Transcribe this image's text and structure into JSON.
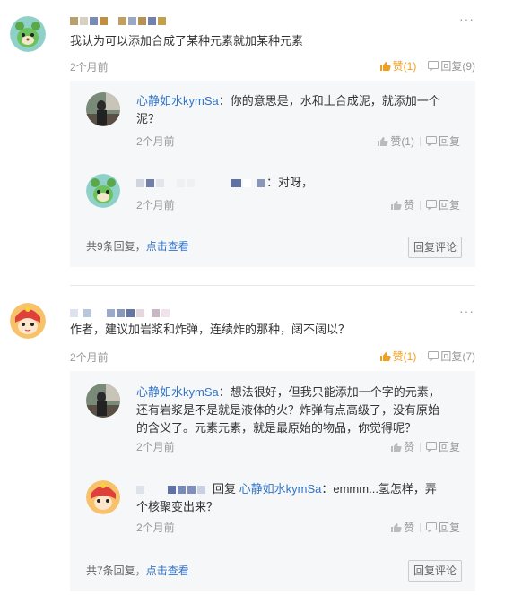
{
  "comments": [
    {
      "user_name": "",
      "text": "我认为可以添加合成了某种元素就加某种元素",
      "time": "2个月前",
      "like_label": "赞(1)",
      "reply_label": "回复(9)",
      "replies": [
        {
          "user_name": "心静如水kymSa",
          "text": "：你的意思是，水和土合成泥，就添加一个",
          "text2": "泥？",
          "time": "2个月前",
          "like_label": "赞(1)",
          "reply_label": "回复"
        },
        {
          "user_name": "",
          "text": "：对呀，",
          "time": "2个月前",
          "like_label": "赞",
          "reply_label": "回复"
        }
      ],
      "total_replies": "共9条回复，",
      "view_more": "点击查看",
      "reply_comment_btn": "回复评论"
    },
    {
      "user_name": "",
      "text": "作者，建议加岩浆和炸弹，连续炸的那种，阔不阔以？",
      "time": "2个月前",
      "like_label": "赞(1)",
      "reply_label": "回复(7)",
      "replies": [
        {
          "user_name": "心静如水kymSa",
          "text": "：想法很好，但我只能添加一个字的元素，",
          "text2": "还有岩浆是不是就是液体的火？炸弹有点高级了，没有原始",
          "text3": "的含义了。元素元素，就是最原始的物品，你觉得呢？",
          "time": "2个月前",
          "like_label": "赞",
          "reply_label": "回复"
        },
        {
          "user_name": "",
          "reply_word": "回复",
          "reply_to": "心静如水kymSa",
          "text": "：emmm...氢怎样，弄",
          "text2": "个核聚变出来？",
          "time": "2个月前",
          "like_label": "赞",
          "reply_label": "回复"
        }
      ],
      "total_replies": "共7条回复，",
      "view_more": "点击查看",
      "reply_comment_btn": "回复评论"
    }
  ],
  "more_icon": "more-dots-icon",
  "colors": {
    "link": "#3275c8",
    "liked": "#f0a020",
    "muted": "#999999"
  }
}
